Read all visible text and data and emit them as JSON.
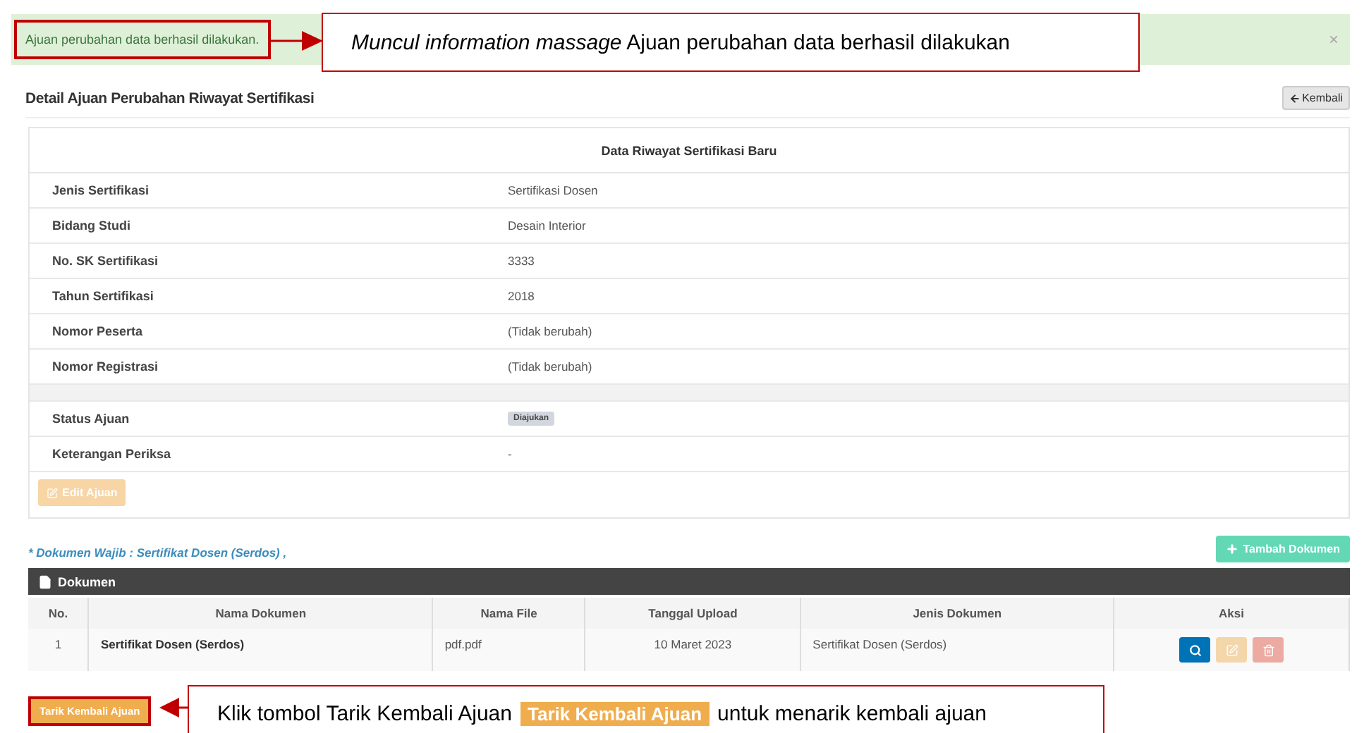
{
  "alert": {
    "text": "Ajuan perubahan data berhasil dilakukan.",
    "close": "×"
  },
  "callout_top": {
    "text": "*Muncul information massage* Ajuan perubahan data berhasil dilakukan"
  },
  "header": {
    "title": "Detail Ajuan Perubahan Riwayat Sertifikasi",
    "back_button": "Kembali"
  },
  "detail": {
    "heading": "Data Riwayat Sertifikasi Baru",
    "rows": [
      {
        "label": "Jenis Sertifikasi",
        "value": "Sertifikasi Dosen"
      },
      {
        "label": "Bidang Studi",
        "value": "Desain Interior"
      },
      {
        "label": "No. SK Sertifikasi",
        "value": "3333"
      },
      {
        "label": "Tahun Sertifikasi",
        "value": "2018"
      },
      {
        "label": "Nomor Peserta",
        "value": "(Tidak berubah)"
      },
      {
        "label": "Nomor Registrasi",
        "value": "(Tidak berubah)"
      }
    ],
    "status_rows": [
      {
        "label": "Status Ajuan",
        "value": "Diajukan",
        "kind": "badge"
      },
      {
        "label": "Keterangan Periksa",
        "value": "-",
        "kind": "text"
      }
    ],
    "edit_button": {
      "label": "Edit Ajuan",
      "disabled": true
    }
  },
  "documents": {
    "note": "* Dokumen Wajib : Sertifikat Dosen (Serdos) ,",
    "add_button": "Tambah Dokumen",
    "panel_title": "Dokumen",
    "columns": [
      "No.",
      "Nama Dokumen",
      "Nama File",
      "Tanggal Upload",
      "Jenis Dokumen",
      "Aksi"
    ],
    "rows": [
      {
        "no": "1",
        "name": "Sertifikat Dosen (Serdos)",
        "file": "pdf.pdf",
        "date": "10 Maret 2023",
        "type": "Sertifikat Dosen (Serdos)",
        "actions": [
          {
            "kind": "view",
            "disabled": false
          },
          {
            "kind": "edit",
            "disabled": true
          },
          {
            "kind": "delete",
            "disabled": true
          }
        ]
      }
    ]
  },
  "withdraw_button": "Tarik Kembali Ajuan",
  "callout_bottom": {
    "before": "Klik tombol Tarik Kembali Ajuan",
    "badge": "Tarik Kembali Ajuan",
    "after": "untuk menarik kembali ajuan"
  }
}
